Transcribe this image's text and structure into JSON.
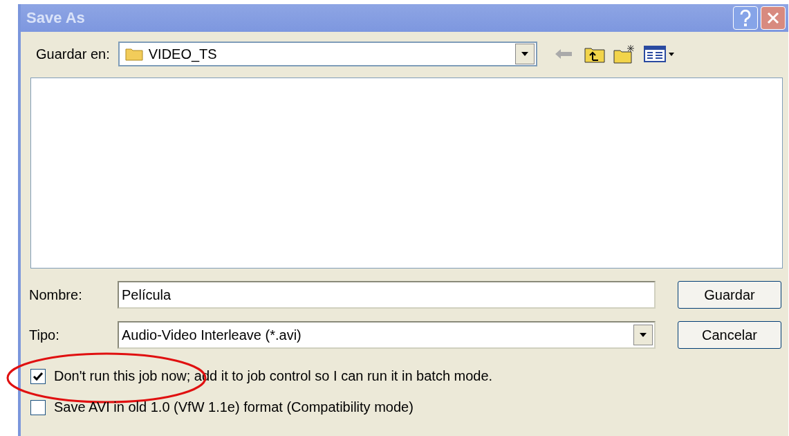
{
  "window": {
    "title": "Save As"
  },
  "location": {
    "label": "Guardar en:",
    "value": "VIDEO_TS"
  },
  "name_field": {
    "label": "Nombre:",
    "value": "Película"
  },
  "type_field": {
    "label": "Tipo:",
    "value": "Audio-Video Interleave (*.avi)"
  },
  "buttons": [
    {
      "label": "Guardar"
    },
    {
      "label": "Cancelar"
    }
  ],
  "options": [
    {
      "label": "Don't run this job now; add it to job control so I can run it in batch mode.",
      "checked": true,
      "highlighted": true
    },
    {
      "label": "Save AVI in old 1.0 (VfW 1.1e) format (Compatibility mode)",
      "checked": false,
      "highlighted": false
    }
  ]
}
